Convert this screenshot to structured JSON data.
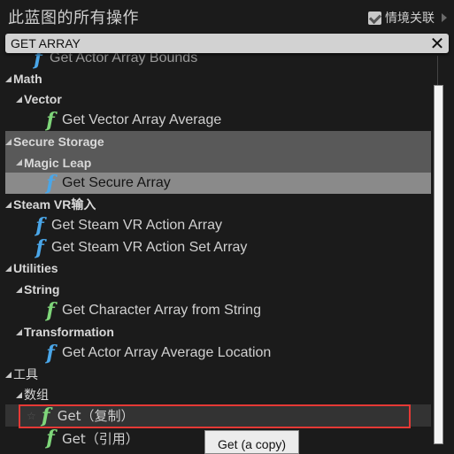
{
  "header": {
    "title": "此蓝图的所有操作",
    "context_sensitive": {
      "label": "情境关联",
      "checked": true
    }
  },
  "search": {
    "value": "GET ARRAY",
    "clear_icon": "close-icon"
  },
  "tree": [
    {
      "type": "function",
      "label": "Get Actor Array Bounds",
      "icon": "function-icon",
      "icon_color": "#4aa6e8",
      "depth": 2,
      "partially_visible": true
    },
    {
      "type": "category",
      "label": "Math",
      "depth": 0,
      "expanded": true
    },
    {
      "type": "category",
      "label": "Vector",
      "depth": 1,
      "expanded": true
    },
    {
      "type": "function",
      "label": "Get Vector Array Average",
      "icon": "function-icon",
      "icon_color": "#7fd67a",
      "depth": 2
    },
    {
      "type": "category",
      "label": "Secure Storage",
      "depth": 0,
      "expanded": true,
      "highlighted": true
    },
    {
      "type": "category",
      "label": "Magic Leap",
      "depth": 1,
      "expanded": true,
      "highlighted": true
    },
    {
      "type": "function",
      "label": "Get Secure Array",
      "icon": "function-icon",
      "icon_color": "#4aa6e8",
      "depth": 2,
      "selected": true
    },
    {
      "type": "category",
      "label": "Steam VR输入",
      "depth": 0,
      "expanded": true
    },
    {
      "type": "function",
      "label": "Get Steam VR Action Array",
      "icon": "function-icon",
      "icon_color": "#4aa6e8",
      "depth": 1
    },
    {
      "type": "function",
      "label": "Get Steam VR Action Set Array",
      "icon": "function-icon",
      "icon_color": "#4aa6e8",
      "depth": 1
    },
    {
      "type": "category",
      "label": "Utilities",
      "depth": 0,
      "expanded": true
    },
    {
      "type": "category",
      "label": "String",
      "depth": 1,
      "expanded": true
    },
    {
      "type": "function",
      "label": "Get Character Array from String",
      "icon": "function-icon",
      "icon_color": "#7fd67a",
      "depth": 2
    },
    {
      "type": "category",
      "label": "Transformation",
      "depth": 1,
      "expanded": true
    },
    {
      "type": "function",
      "label": "Get Actor Array Average Location",
      "icon": "function-icon",
      "icon_color": "#4aa6e8",
      "depth": 2
    },
    {
      "type": "category",
      "label": "工具",
      "depth": 0,
      "expanded": true
    },
    {
      "type": "category",
      "label": "数组",
      "depth": 1,
      "expanded": true
    },
    {
      "type": "function",
      "label": "Get（复制）",
      "icon": "function-icon",
      "icon_color": "#7fd67a",
      "depth": 2,
      "hovered": true,
      "favorite_icon": "star-icon",
      "annotated": true
    },
    {
      "type": "function",
      "label": "Get（引用）",
      "icon": "function-icon",
      "icon_color": "#7fd67a",
      "depth": 2
    }
  ],
  "tooltip": {
    "text": "Get (a copy)"
  },
  "colors": {
    "annotation_box": "#e53935",
    "selected_row": "#8a8a8a",
    "highlighted_section": "#595959"
  }
}
